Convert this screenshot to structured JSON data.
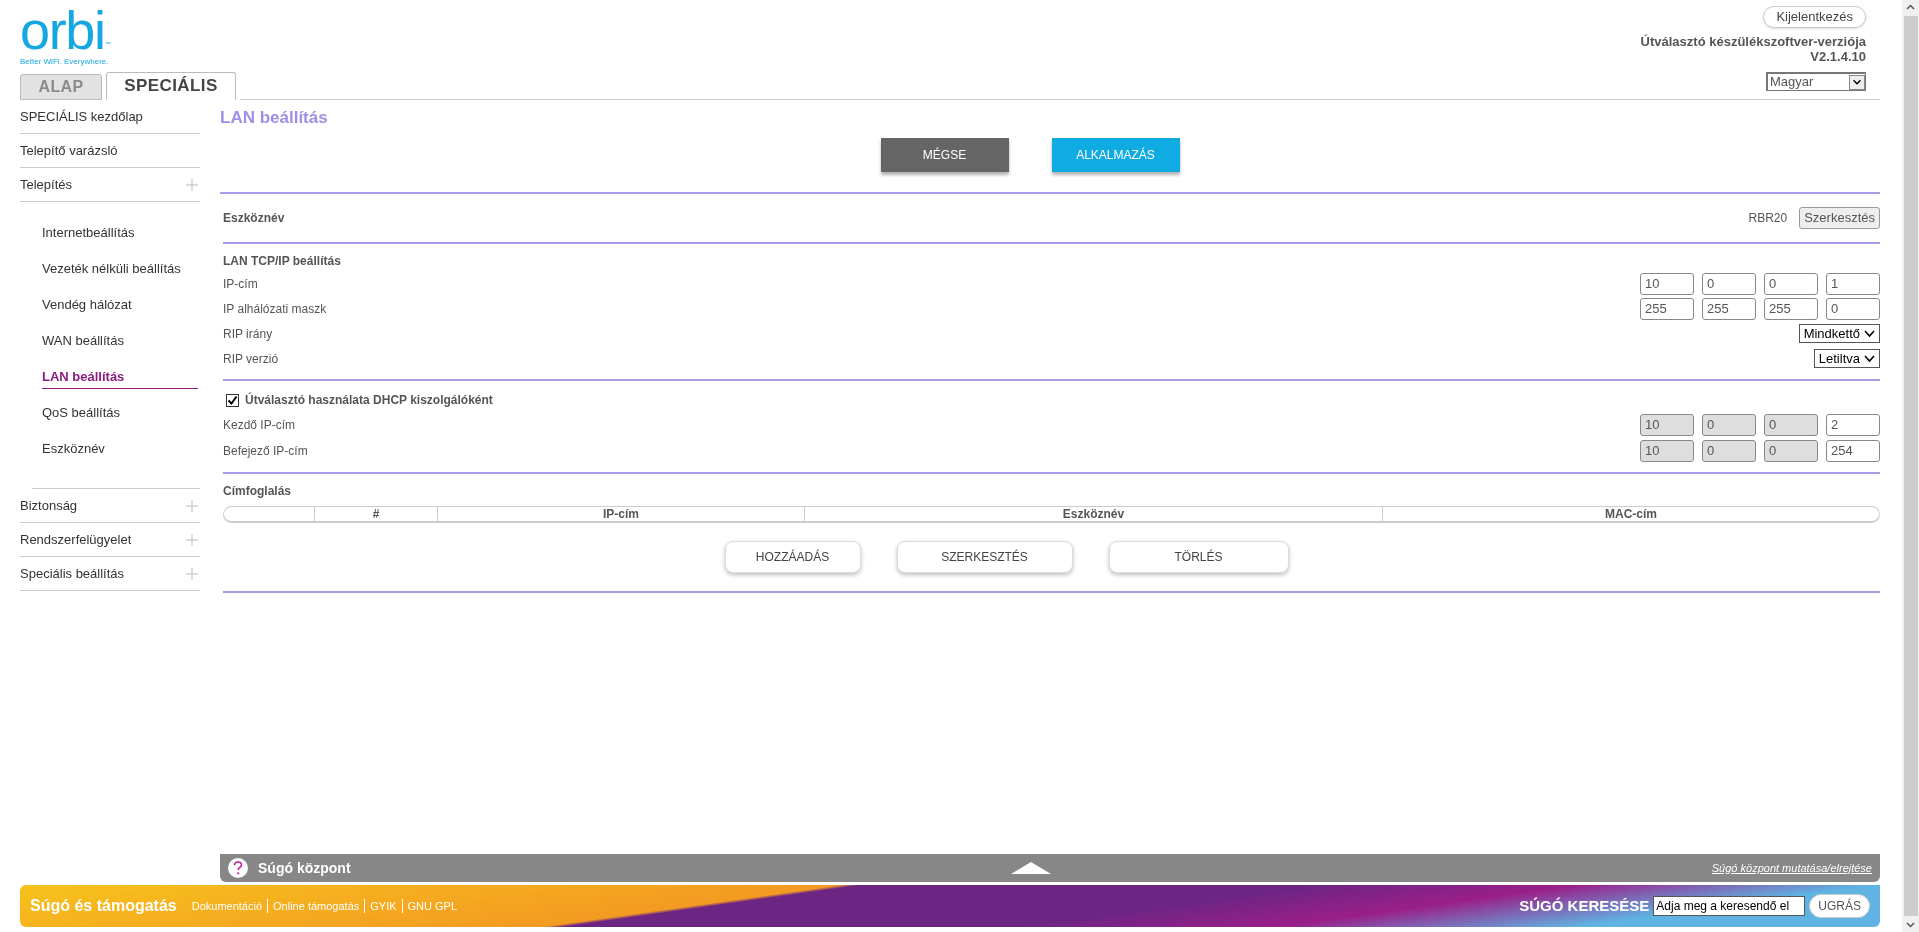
{
  "header": {
    "logo": {
      "wordmark": "orbi",
      "trademark": "™",
      "tagline": "Better WiFi. Everywhere."
    },
    "logout_button": "Kijelentkezés",
    "firmware_label": "Útválasztó készülékszoftver-verziója",
    "firmware_version": "V2.1.4.10",
    "language": "Magyar"
  },
  "tabs": [
    {
      "label": "ALAP",
      "selected": false
    },
    {
      "label": "SPECIÁLIS",
      "selected": true
    }
  ],
  "sidebar": {
    "items": [
      {
        "label": "SPECIÁLIS kezdőlap",
        "expandable": false,
        "selected": false
      },
      {
        "label": "Telepítő varázsló",
        "expandable": false,
        "selected": false
      },
      {
        "label": "Telepítés",
        "expandable": true,
        "selected": false,
        "children": [
          {
            "label": "Internetbeállítás",
            "selected": false
          },
          {
            "label": "Vezeték nélküli beállítás",
            "selected": false
          },
          {
            "label": "Vendég hálózat",
            "selected": false
          },
          {
            "label": "WAN beállítás",
            "selected": false
          },
          {
            "label": "LAN beállítás",
            "selected": true
          },
          {
            "label": "QoS beállítás",
            "selected": false
          },
          {
            "label": "Eszköznév",
            "selected": false
          }
        ]
      },
      {
        "label": "Biztonság",
        "expandable": true,
        "selected": false
      },
      {
        "label": "Rendszerfelügyelet",
        "expandable": true,
        "selected": false
      },
      {
        "label": "Speciális beállítás",
        "expandable": true,
        "selected": false
      }
    ]
  },
  "page": {
    "title": "LAN beállítás",
    "buttons": [
      {
        "label": "MÉGSE",
        "kind": "cancel"
      },
      {
        "label": "ALKALMAZÁS",
        "kind": "apply"
      }
    ],
    "device_name": {
      "label": "Eszköznév",
      "value": "RBR20",
      "edit_button": "Szerkesztés"
    },
    "lan_tcpip": {
      "heading": "LAN TCP/IP beállítás",
      "rows": [
        {
          "kind": "ip",
          "label": "IP-cím",
          "octets": [
            {
              "value": "10",
              "disabled": false
            },
            {
              "value": "0",
              "disabled": false
            },
            {
              "value": "0",
              "disabled": false
            },
            {
              "value": "1",
              "disabled": false
            }
          ]
        },
        {
          "kind": "ip",
          "label": "IP alhálózati maszk",
          "octets": [
            {
              "value": "255",
              "disabled": false
            },
            {
              "value": "255",
              "disabled": false
            },
            {
              "value": "255",
              "disabled": false
            },
            {
              "value": "0",
              "disabled": false
            }
          ]
        },
        {
          "kind": "select",
          "label": "RIP irány",
          "value": "Mindkettő"
        },
        {
          "kind": "select",
          "label": "RIP verzió",
          "value": "Letiltva"
        }
      ]
    },
    "dhcp": {
      "label": "Útválasztó használata DHCP kiszolgálóként",
      "checked": true,
      "rows": [
        {
          "kind": "ip",
          "label": "Kezdő IP-cím",
          "octets": [
            {
              "value": "10",
              "disabled": true
            },
            {
              "value": "0",
              "disabled": true
            },
            {
              "value": "0",
              "disabled": true
            },
            {
              "value": "2",
              "disabled": false
            }
          ]
        },
        {
          "kind": "ip",
          "label": "Befejező IP-cím",
          "octets": [
            {
              "value": "10",
              "disabled": true
            },
            {
              "value": "0",
              "disabled": true
            },
            {
              "value": "0",
              "disabled": true
            },
            {
              "value": "254",
              "disabled": false
            }
          ]
        }
      ]
    },
    "reservation": {
      "heading": "Címfoglalás",
      "columns": [
        "#",
        "IP-cím",
        "Eszköznév",
        "MAC-cím"
      ],
      "buttons": [
        "HOZZÁADÁS",
        "SZERKESZTÉS",
        "TÖRLÉS"
      ]
    }
  },
  "help_center": {
    "title": "Súgó központ",
    "toggle_link": "Súgó központ mutatása/elrejtése"
  },
  "footer": {
    "title": "Súgó és támogatás",
    "links": [
      "Dokumentáció",
      "Online támogatás",
      "GYIK",
      "GNU GPL"
    ],
    "search_label": "SÚGÓ KERESÉSE",
    "search_value": "Adja meg a keresendő el",
    "go_button": "UGRÁS"
  }
}
